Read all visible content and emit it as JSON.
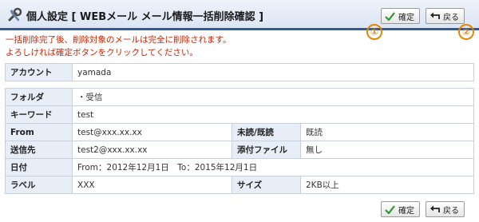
{
  "header": {
    "title": "個人設定 [ WEBメール  メール情報一括削除確認 ]",
    "buttons": {
      "confirm": "確定",
      "back": "戻る"
    }
  },
  "markers": {
    "one": "①",
    "two": "②"
  },
  "notice": {
    "line1": "一括削除完了後、削除対象のメールは完全に削除されます。",
    "line2": "よろしければ確定ボタンをクリックしてください。"
  },
  "account": {
    "label": "アカウント",
    "value": "yamada"
  },
  "folder": {
    "label": "フォルダ",
    "value": "・受信"
  },
  "keyword": {
    "label": "キーワード",
    "value": "test"
  },
  "from": {
    "label": "From",
    "value": "test@xxx.xx.xx"
  },
  "read_status": {
    "label": "未読/既読",
    "value": "既読"
  },
  "to": {
    "label": "送信先",
    "value": "test2@xxx.xx.xx"
  },
  "attachment": {
    "label": "添付ファイル",
    "value": "無し"
  },
  "date": {
    "label": "日付",
    "value": "From：2012年12月1日　To：2015年12月1日"
  },
  "label_field": {
    "label": "ラベル",
    "value": "XXX"
  },
  "size": {
    "label": "サイズ",
    "value": "2KB以上"
  },
  "footer": {
    "buttons": {
      "confirm": "確定",
      "back": "戻る"
    }
  },
  "colors": {
    "accent": "#2f5a9e",
    "notice": "#cc2200",
    "marker": "#e08800",
    "label_bg": "#e8eef7"
  }
}
